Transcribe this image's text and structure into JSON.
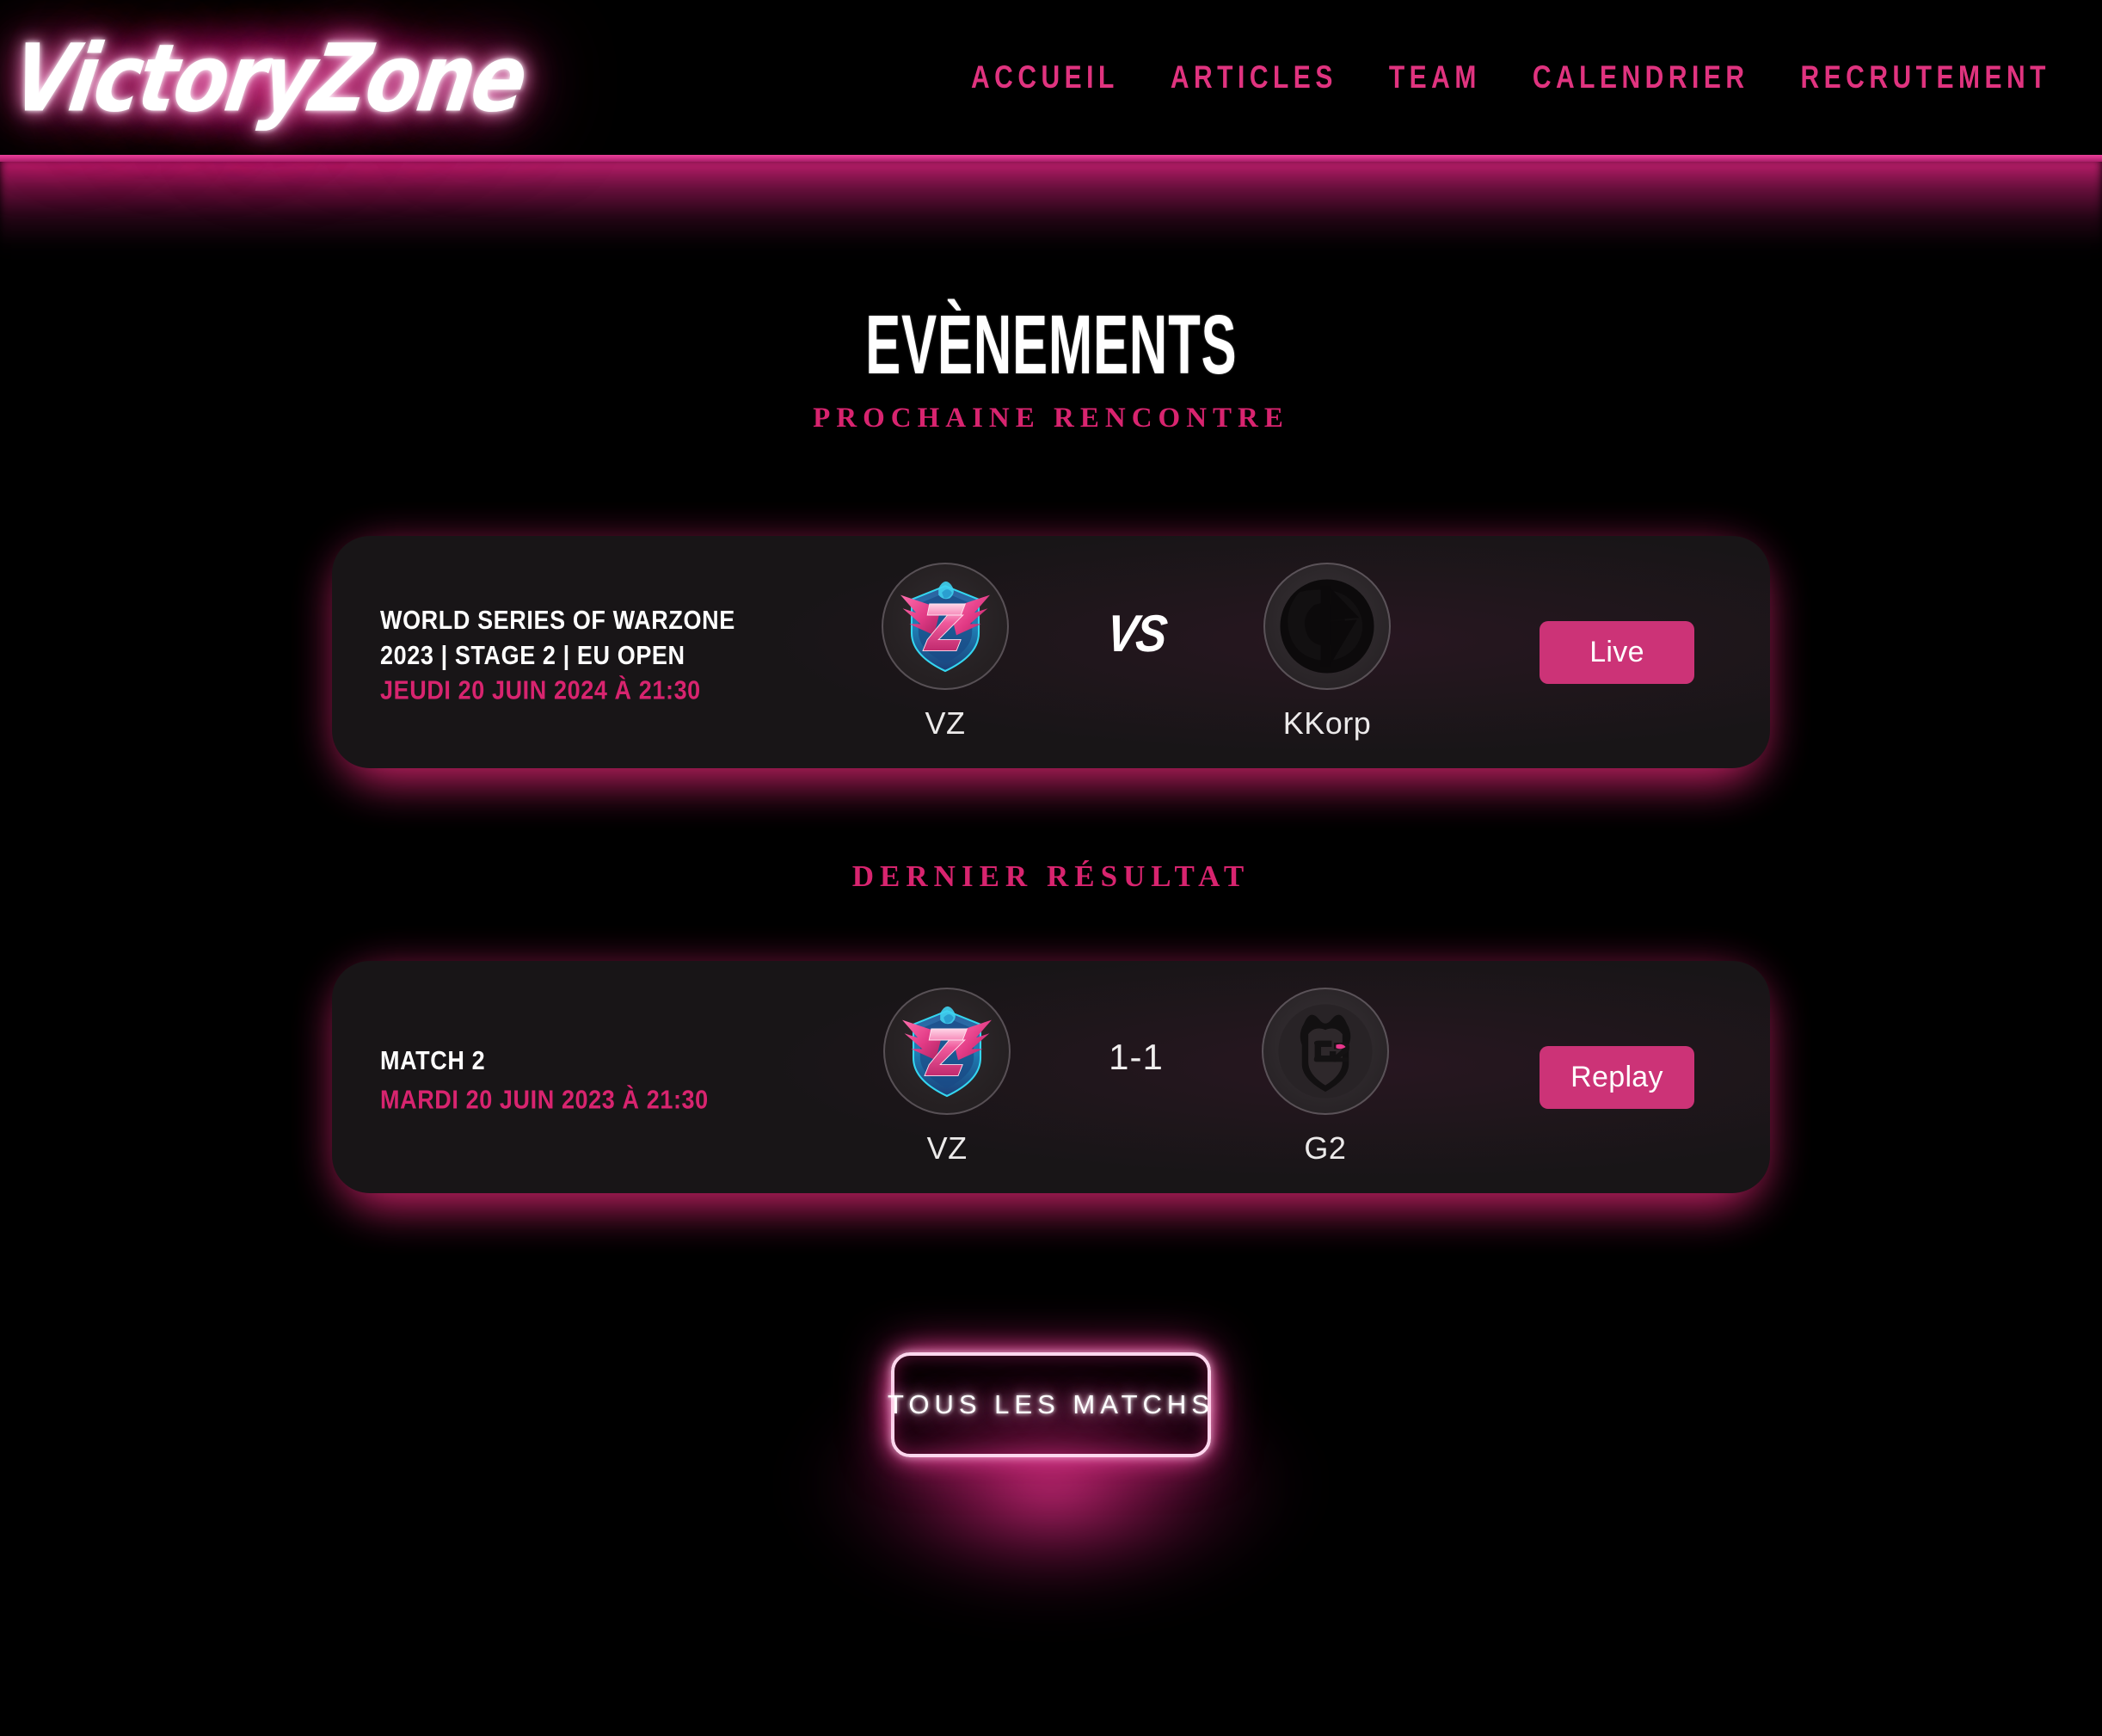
{
  "header": {
    "logo_text": "VictoryZone",
    "nav": [
      {
        "label": "ACCUEIL"
      },
      {
        "label": "ARTICLES"
      },
      {
        "label": "TEAM"
      },
      {
        "label": "CALENDRIER"
      },
      {
        "label": "RECRUTEMENT"
      }
    ]
  },
  "main": {
    "title": "EVÈNEMENTS",
    "subtitle": "PROCHAINE RENCONTRE",
    "results_label": "DERNIER RÉSULTAT",
    "cta_label": "TOUS LES MATCHS"
  },
  "upcoming_match": {
    "title": "WORLD SERIES OF WARZONE 2023 | STAGE 2 | EU OPEN",
    "date": "JEUDI 20 JUIN 2024 À 21:30",
    "home_team": "VZ",
    "away_team": "KKorp",
    "separator": "VS",
    "action_label": "Live"
  },
  "last_result": {
    "title": "MATCH 2",
    "date": "MARDI 20 JUIN 2023 À 21:30",
    "home_team": "VZ",
    "away_team": "G2",
    "score": "1-1",
    "action_label": "Replay"
  },
  "colors": {
    "accent_pink": "#d8246f",
    "button_pink": "#cc3377",
    "neon_pink": "#e8329a",
    "card_bg": "#181517",
    "page_bg": "#000000",
    "text_white": "#ffffff"
  }
}
